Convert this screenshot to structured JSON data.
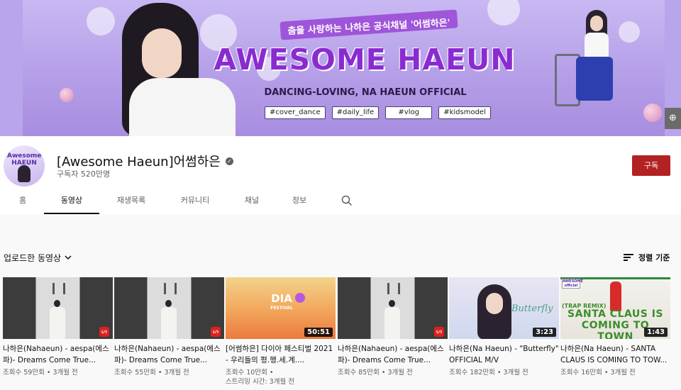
{
  "banner": {
    "tagline": "춤을 사랑하는 나하은 공식채널 '어썸하은'",
    "title": "AWESOME HAEUN",
    "subtitle": "DANCING-LOVING, NA HAEUN OFFICIAL",
    "tags": [
      "#cover_dance",
      "#daily_life",
      "#vlog",
      "#kidsmodel"
    ]
  },
  "avatar": {
    "text": "Awesome HAEUN"
  },
  "channel": {
    "name": "[Awesome Haeun]어썸하은",
    "subscribers": "구독자 520만명",
    "subscribe_label": "구독"
  },
  "tabs": [
    "홈",
    "동영상",
    "재생목록",
    "커뮤니티",
    "채널",
    "정보"
  ],
  "active_tab": "동영상",
  "filter_label": "업로드한 동영상",
  "sort_label": "정렬 기준",
  "videos": [
    {
      "title": "나하은(Nahaeun) - aespa(에스파)- Dreams Come True...",
      "meta": "조회수 59만회 • 3개월 전",
      "badge": "shorts"
    },
    {
      "title": "나하은(Nahaeun) - aespa(에스파)- Dreams Come True...",
      "meta": "조회수 55만회 • 3개월 전",
      "badge": "shorts"
    },
    {
      "title": "[어썸하은] 다이아 페스티벌 2021 - 우리들의 평.행.세.계....",
      "meta": "조회수 10만회 •",
      "meta2": "스트리밍 시간: 3개월 전",
      "duration": "50:51"
    },
    {
      "title": "나하은(Nahaeun) - aespa(에스파)- Dreams Come True...",
      "meta": "조회수 85만회 • 3개월 전",
      "badge": "shorts"
    },
    {
      "title": "나하은(Na Haeun) - \"Butterfly\" OFFICIAL M/V",
      "meta": "조회수 182만회 • 3개월 전",
      "duration": "3:23"
    },
    {
      "title": "나하은(Na Haeun) - SANTA CLAUS IS COMING TO TOW...",
      "meta": "조회수 16만회 • 3개월 전",
      "duration": "1:43"
    }
  ],
  "thumbs": {
    "fest_logo": "DIA",
    "fest_sub": "FESTIVAL",
    "butterfly_script": "Butterfly",
    "santa_small": "(TRAP REMIX)",
    "santa_text": "SANTA CLAUS IS COMING TO TOWN",
    "santa_mini": "AWESOME official"
  },
  "icons": {
    "globe": "globe-icon",
    "verified": "verified-check-icon",
    "search": "search-icon",
    "sort": "sort-icon",
    "chevron": "chevron-down-icon",
    "shorts": "shorts-icon"
  },
  "colors": {
    "subscribe": "#b22222",
    "banner_title": "#8a2bd0",
    "banner_bg": "#b8a5ec"
  }
}
